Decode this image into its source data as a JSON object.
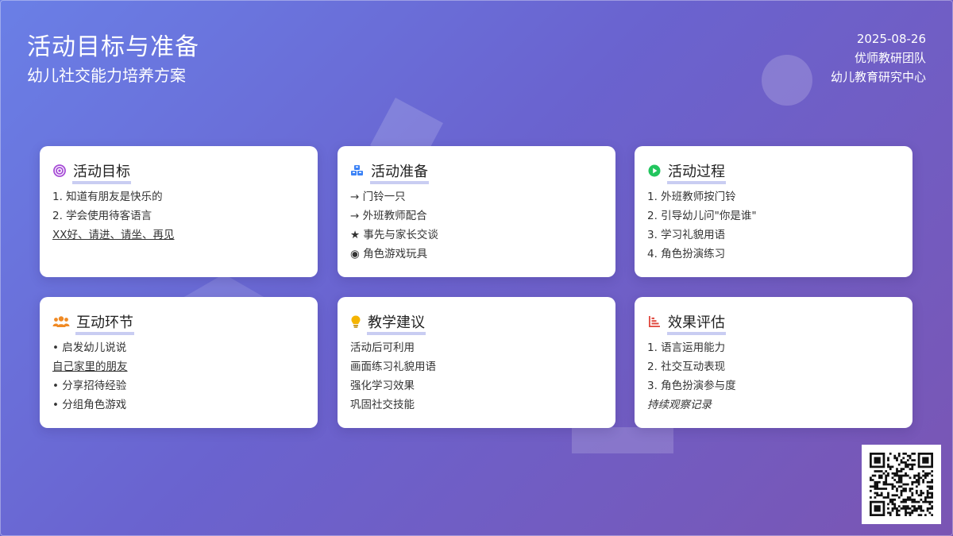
{
  "header": {
    "title": "活动目标与准备",
    "subtitle": "幼儿社交能力培养方案",
    "date": "2025-08-26",
    "team": "优师教研团队",
    "center": "幼儿教育研究中心"
  },
  "cards": [
    {
      "title": "活动目标",
      "icon": "target-icon",
      "icon_color": "#a64bd6",
      "items": [
        "1. 知道有朋友是快乐的",
        "2. 学会使用待客语言",
        "XX好、请进、请坐、再见"
      ]
    },
    {
      "title": "活动准备",
      "icon": "cubes-icon",
      "icon_color": "#3b82f6",
      "items": [
        "→ 门铃一只",
        "→ 外班教师配合",
        "★ 事先与家长交谈",
        "◉ 角色游戏玩具"
      ]
    },
    {
      "title": "活动过程",
      "icon": "play-circle-icon",
      "icon_color": "#22c55e",
      "items": [
        "1. 外班教师按门铃",
        "2. 引导幼儿问\"你是谁\"",
        "3. 学习礼貌用语",
        "4. 角色扮演练习"
      ]
    },
    {
      "title": "互动环节",
      "icon": "users-icon",
      "icon_color": "#f08a24",
      "items": [
        "• 启发幼儿说说",
        "自己家里的朋友",
        "• 分享招待经验",
        "• 分组角色游戏"
      ]
    },
    {
      "title": "教学建议",
      "icon": "lightbulb-icon",
      "icon_color": "#f5b400",
      "items": [
        "活动后可利用",
        "画面练习礼貌用语",
        "强化学习效果",
        "巩固社交技能"
      ]
    },
    {
      "title": "效果评估",
      "icon": "bar-chart-icon",
      "icon_color": "#e0483e",
      "items": [
        "1. 语言运用能力",
        "2. 社交互动表现",
        "3. 角色扮演参与度",
        "持续观察记录"
      ]
    }
  ]
}
